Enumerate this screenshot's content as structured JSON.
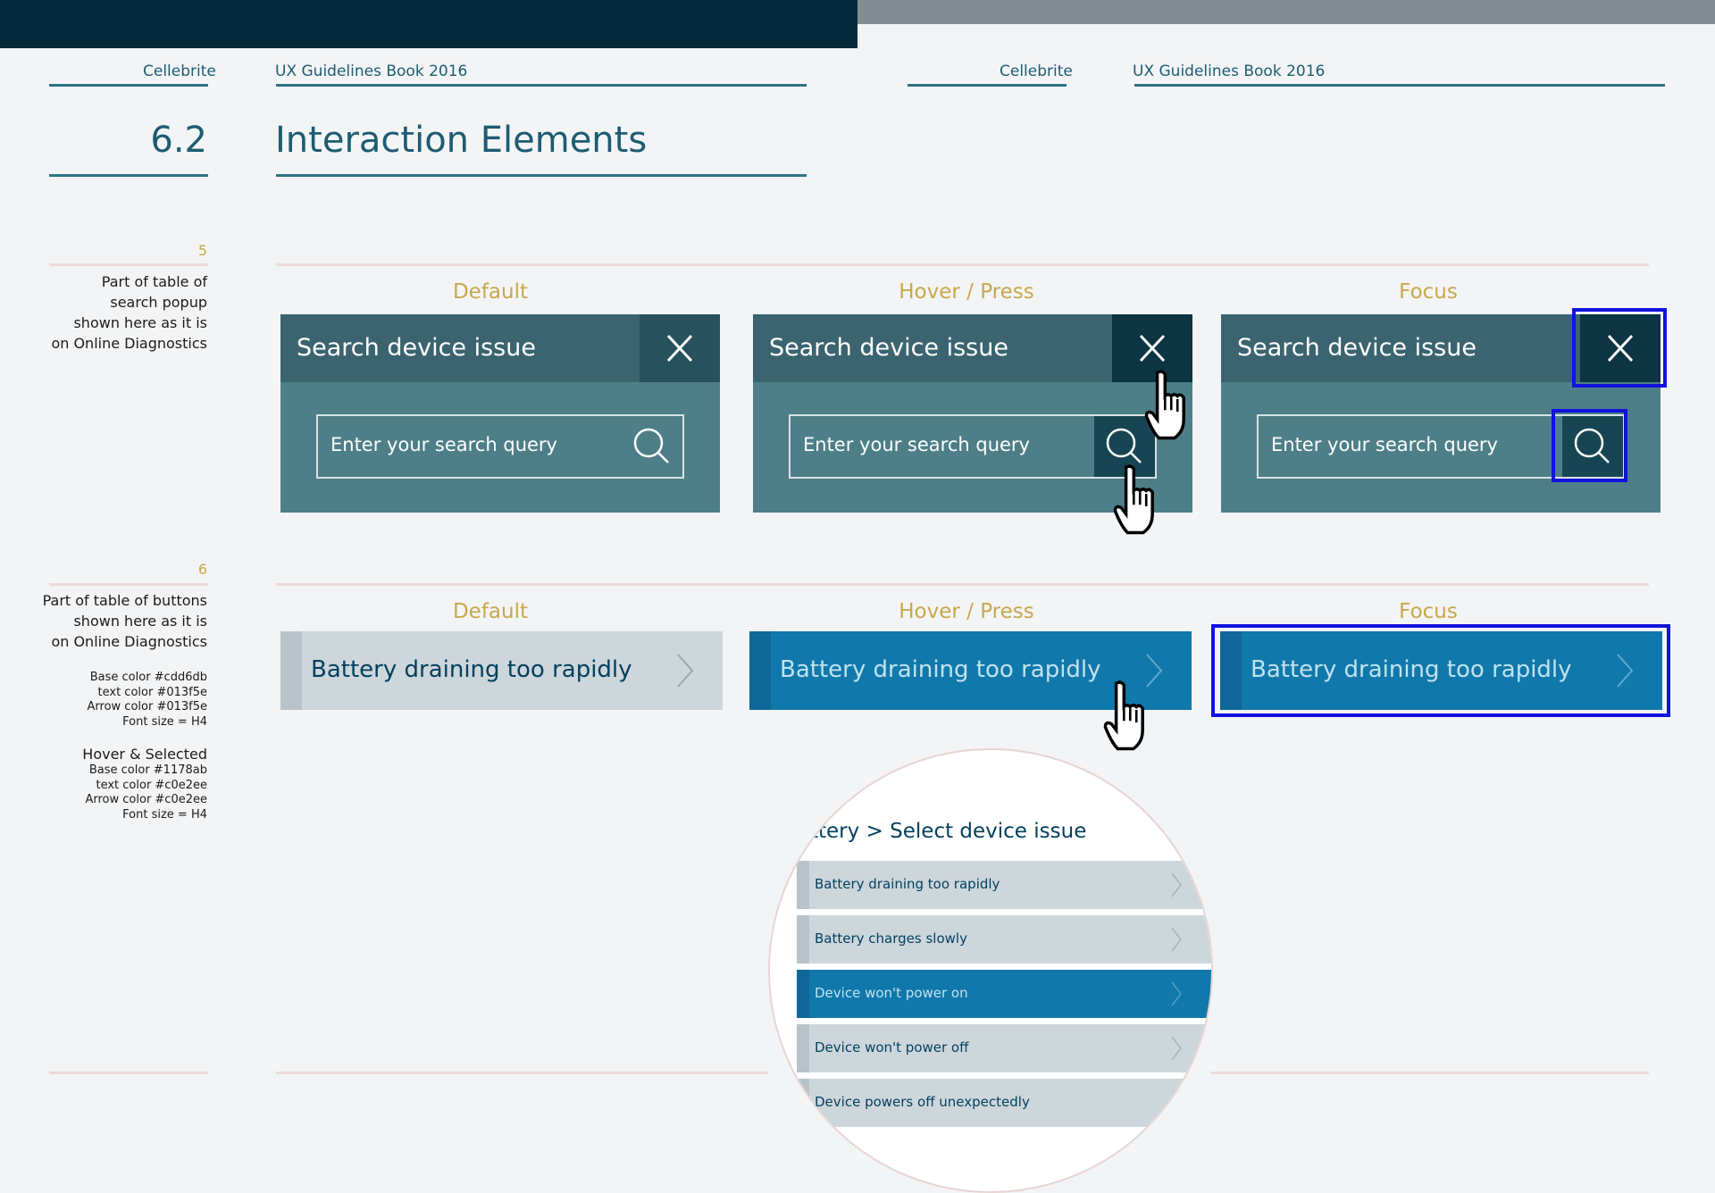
{
  "header": {
    "left_brand": "Cellebrite",
    "left_book": "UX Guidelines Book 2016",
    "right_brand": "Cellebrite",
    "right_book": "UX Guidelines Book 2016"
  },
  "section": {
    "number": "6.2",
    "title": "Interaction Elements"
  },
  "notes": [
    {
      "number": "5",
      "lines": [
        "Part of table of",
        "search popup",
        "shown here as it is",
        "on Online Diagnostics"
      ]
    },
    {
      "number": "6",
      "lines": [
        "Part of table of buttons",
        "shown here as it is",
        "on Online Diagnostics"
      ],
      "spec_default": [
        "Base color #cdd6db",
        "text color #013f5e",
        "Arrow color #013f5e",
        "Font size = H4"
      ],
      "spec_hover_title": "Hover & Selected",
      "spec_hover": [
        "Base color #1178ab",
        "text color #c0e2ee",
        "Arrow color #c0e2ee",
        "Font size = H4"
      ]
    }
  ],
  "states": [
    "Default",
    "Hover / Press",
    "Focus"
  ],
  "search_popup": {
    "title": "Search device issue",
    "close_label": "X",
    "placeholder": "Enter your search query"
  },
  "list_button": {
    "label": "Battery draining too rapidly"
  },
  "magnifier": {
    "breadcrumb": "ttery > Select device issue",
    "items": [
      "Battery draining too rapidly",
      "Battery charges slowly",
      "Device won't power on",
      "Device won't power off",
      "Device powers off unexpectedly"
    ],
    "selected_index": 2
  },
  "colors": {
    "default_base": "#cdd6db",
    "default_text": "#013f5e",
    "hover_base": "#1178ab",
    "hover_text": "#c0e2ee",
    "focus_ring": "#1212dc",
    "label_gold": "#c9a84a"
  }
}
